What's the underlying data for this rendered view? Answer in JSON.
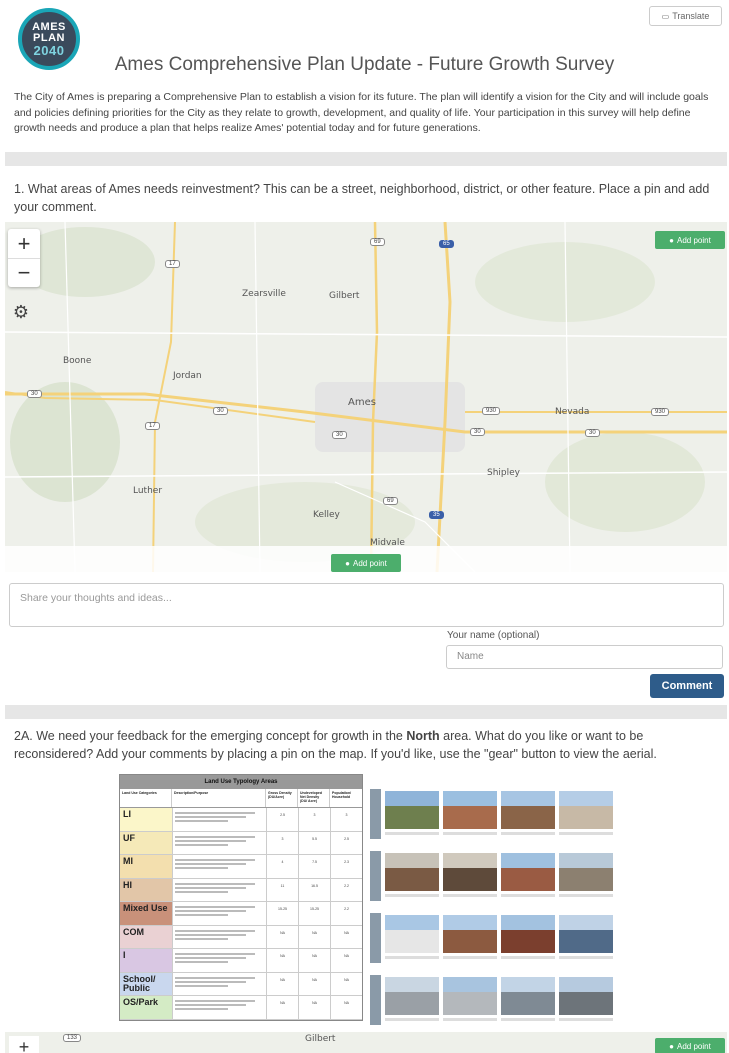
{
  "header": {
    "translate_label": "Translate",
    "logo": {
      "line1": "AMES",
      "line2": "PLAN",
      "line3": "2040"
    },
    "title": "Ames Comprehensive Plan Update - Future Growth Survey"
  },
  "intro_text": "The City of Ames is preparing a Comprehensive Plan to establish a vision for its future. The plan will identify a vision for the City and will include goals and policies defining priorities for the City as they relate to growth, development, and quality of life. Your participation in this survey will help define growth needs and produce a plan that helps realize Ames' potential today and for future generations.",
  "question1": {
    "text": "1. What areas of Ames needs reinvestment? This can be a street, neighborhood, district, or other feature. Place a pin and add your comment.",
    "map": {
      "zoom_in": "+",
      "zoom_out": "−",
      "add_point_label": "Add point",
      "places": [
        "Zearsville",
        "Gilbert",
        "Boone",
        "Jordan",
        "Ames",
        "Nevada",
        "Shipley",
        "Luther",
        "Kelley",
        "Midvale"
      ],
      "route_numbers": [
        "69",
        "65",
        "17",
        "30",
        "30",
        "17",
        "30",
        "930",
        "930",
        "30",
        "30",
        "69",
        "35"
      ]
    },
    "comment_placeholder": "Share your thoughts and ideas...",
    "name_label": "Your name (optional)",
    "name_placeholder": "Name",
    "comment_button": "Comment"
  },
  "question2a": {
    "text_prefix": "2A. We need your feedback for the emerging concept for growth in the ",
    "text_bold": "North",
    "text_suffix": " area. What do you like or want to be reconsidered? Add your comments by placing a pin on the map. If you'd like, use the \"gear\" button to view the aerial.",
    "typology": {
      "title": "Land Use Typology Areas",
      "headers": [
        "Land Use Categories",
        "Description/Purpose",
        "Gross Density (DU/Acre)",
        "Undeveloped Net Density (DU/ Acre)",
        "Population/ Household"
      ],
      "rows": [
        {
          "code": "LI",
          "color": "#fbf6c9",
          "n1": "2.5",
          "n2": "3",
          "n3": "3"
        },
        {
          "code": "UF",
          "color": "#f5e9b8",
          "n1": "3",
          "n2": "5.5",
          "n3": "2.5"
        },
        {
          "code": "MI",
          "color": "#f3dfae",
          "n1": "4",
          "n2": "7.5",
          "n3": "2.3"
        },
        {
          "code": "HI",
          "color": "#e2c6a8",
          "n1": "11",
          "n2": "16.5",
          "n3": "2.2"
        },
        {
          "code": "Mixed Use",
          "color": "#c9917a",
          "n1": "15-25",
          "n2": "15-25",
          "n3": "2.2"
        },
        {
          "code": "COM",
          "color": "#ead1d3",
          "n1": "NA",
          "n2": "NA",
          "n3": "NA"
        },
        {
          "code": "I",
          "color": "#d9c7e3",
          "n1": "NA",
          "n2": "NA",
          "n3": "NA"
        },
        {
          "code": "School/ Public",
          "color": "#c9d7ee",
          "n1": "NA",
          "n2": "NA",
          "n3": "NA"
        },
        {
          "code": "OS/Park",
          "color": "#d4ebc5",
          "n1": "NA",
          "n2": "NA",
          "n3": "NA"
        }
      ]
    },
    "bottom_map": {
      "route_number": "133",
      "place": "Gilbert",
      "zoom_in": "+",
      "add_point_label": "Add point"
    }
  },
  "colors": {
    "accent_green": "#4cae6c",
    "comment_blue": "#2e5c8a",
    "logo_ring": "#1aa6b7"
  }
}
